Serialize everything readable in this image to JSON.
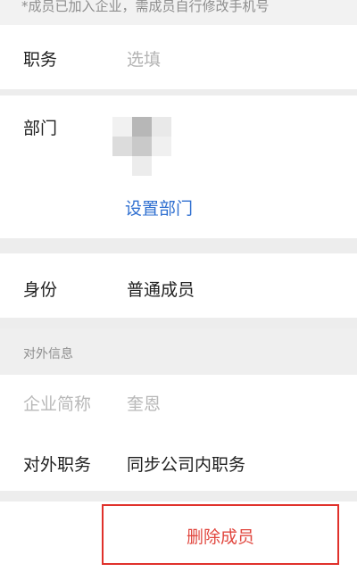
{
  "notice": "*成员已加入企业，需成员自行修改手机号",
  "position": {
    "label": "职务",
    "placeholder": "选填"
  },
  "department": {
    "label": "部门",
    "set_link": "设置部门"
  },
  "identity": {
    "label": "身份",
    "value": "普通成员"
  },
  "external_info": {
    "section_title": "对外信息",
    "company_short_name": {
      "label": "企业简称",
      "value": "奎恩"
    },
    "external_position": {
      "label": "对外职务",
      "value": "同步公司内职务"
    }
  },
  "actions": {
    "delete_member": "删除成员"
  }
}
